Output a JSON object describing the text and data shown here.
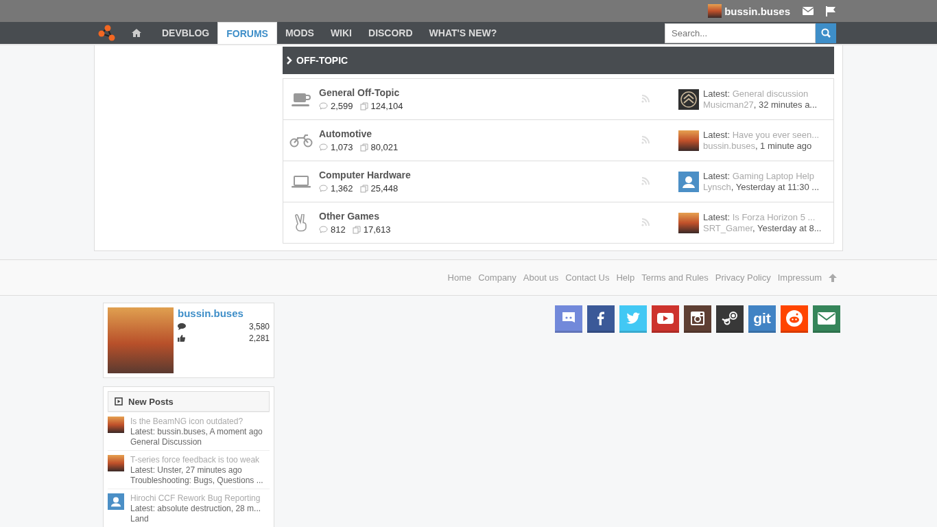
{
  "top_bar": {
    "username": "bussin.buses"
  },
  "nav": {
    "items": [
      {
        "label": "DEVBLOG",
        "selected": false
      },
      {
        "label": "FORUMS",
        "selected": true
      },
      {
        "label": "MODS",
        "selected": false
      },
      {
        "label": "WIKI",
        "selected": false
      },
      {
        "label": "DISCORD",
        "selected": false
      },
      {
        "label": "WHAT'S NEW?",
        "selected": false
      }
    ],
    "search": {
      "placeholder": "Search..."
    }
  },
  "category": {
    "title": "OFF-TOPIC"
  },
  "forums": [
    {
      "kind": "cup",
      "name": "General Off-Topic",
      "threads": "2,599",
      "messages": "124,104",
      "latest_label": "Latest:",
      "latest_title": "General discussion",
      "latest_user": "Musicman27",
      "latest_time": ", 32 minutes a...",
      "avatar": {
        "kind": "emblem"
      }
    },
    {
      "kind": "motorbike",
      "name": "Automotive",
      "threads": "1,073",
      "messages": "80,021",
      "latest_label": "Latest:",
      "latest_title": "Have you ever seen...",
      "latest_user": "bussin.buses",
      "latest_time": ", 1 minute ago",
      "avatar": {
        "kind": "photo"
      }
    },
    {
      "kind": "laptop",
      "name": "Computer Hardware",
      "threads": "1,362",
      "messages": "25,448",
      "latest_label": "Latest:",
      "latest_title": "Gaming Laptop Help",
      "latest_user": "Lynsch",
      "latest_time": ", Yesterday at 11:30 ...",
      "avatar": {
        "kind": "default"
      }
    },
    {
      "kind": "hand",
      "name": "Other Games",
      "threads": "812",
      "messages": "17,613",
      "latest_label": "Latest:",
      "latest_title": "Is Forza Horizon 5 ...",
      "latest_user": "SRT_Gamer",
      "latest_time": ", Yesterday at 8...",
      "avatar": {
        "kind": "photo"
      }
    }
  ],
  "footer_links": [
    "Home",
    "Company",
    "About us",
    "Contact Us",
    "Help",
    "Terms and Rules",
    "Privacy Policy",
    "Impressum"
  ],
  "user_card": {
    "username": "bussin.buses",
    "messages": "3,580",
    "likes": "2,281"
  },
  "new_posts": {
    "title": "New Posts",
    "items": [
      {
        "title": "Is the BeamNG icon outdated?",
        "latest": "Latest: bussin.buses, A moment ago",
        "forum": "General Discussion",
        "avatar": {
          "kind": "photo"
        }
      },
      {
        "title": "T-series force feedback is too weak",
        "latest": "Latest: Unster, 27 minutes ago",
        "forum": "Troubleshooting: Bugs, Questions ...",
        "avatar": {
          "kind": "photo"
        }
      },
      {
        "title": "Hirochi CCF Rework Bug Reporting",
        "latest": "Latest: absolute destruction, 28 m...",
        "forum": "Land",
        "avatar": {
          "kind": "default"
        }
      }
    ]
  },
  "social": [
    {
      "kind": "discord"
    },
    {
      "kind": "facebook"
    },
    {
      "kind": "twitter"
    },
    {
      "kind": "youtube"
    },
    {
      "kind": "instagram"
    },
    {
      "kind": "steam"
    },
    {
      "kind": "github",
      "label": "git"
    },
    {
      "kind": "reddit"
    },
    {
      "kind": "email"
    }
  ]
}
